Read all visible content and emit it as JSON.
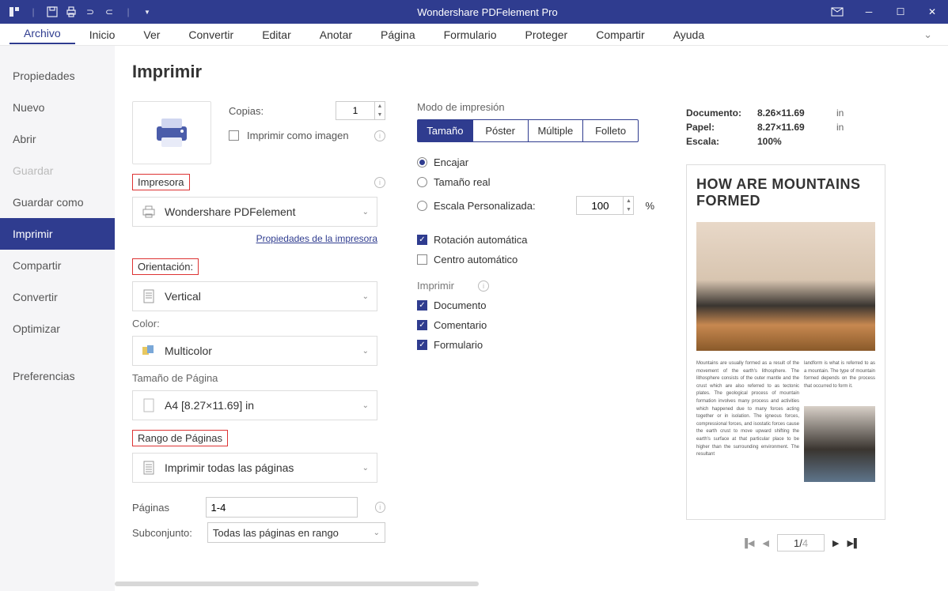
{
  "app_title": "Wondershare PDFelement Pro",
  "menu": {
    "items": [
      "Archivo",
      "Inicio",
      "Ver",
      "Convertir",
      "Editar",
      "Anotar",
      "Página",
      "Formulario",
      "Proteger",
      "Compartir",
      "Ayuda"
    ],
    "active": "Archivo"
  },
  "sidebar": {
    "items": [
      {
        "label": "Propiedades"
      },
      {
        "label": "Nuevo"
      },
      {
        "label": "Abrir"
      },
      {
        "label": "Guardar",
        "disabled": true
      },
      {
        "label": "Guardar como"
      },
      {
        "label": "Imprimir",
        "active": true
      },
      {
        "label": "Compartir"
      },
      {
        "label": "Convertir"
      },
      {
        "label": "Optimizar"
      }
    ],
    "prefs": "Preferencias"
  },
  "print": {
    "title": "Imprimir",
    "copies_label": "Copias:",
    "copies_value": "1",
    "print_as_image": "Imprimir como imagen",
    "printer_section": "Impresora",
    "printer_value": "Wondershare PDFelement",
    "printer_props_link": "Propiedades de la impresora",
    "orientation_section": "Orientación:",
    "orientation_value": "Vertical",
    "color_section": "Color:",
    "color_value": "Multicolor",
    "page_size_section": "Tamaño de Página",
    "page_size_value": "A4 [8.27×11.69] in",
    "page_range_section": "Rango de Páginas",
    "page_range_value": "Imprimir todas las páginas",
    "pages_label": "Páginas",
    "pages_value": "1-4",
    "subset_label": "Subconjunto:",
    "subset_value": "Todas las páginas en rango"
  },
  "mode": {
    "label": "Modo de impresión",
    "tabs": [
      "Tamaño",
      "Póster",
      "Múltiple",
      "Folleto"
    ],
    "fit": "Encajar",
    "actual": "Tamaño real",
    "custom": "Escala Personalizada:",
    "scale_value": "100",
    "percent": "%",
    "auto_rotate": "Rotación automática",
    "auto_center": "Centro automático",
    "print_label": "Imprimir",
    "print_doc": "Documento",
    "print_comment": "Comentario",
    "print_form": "Formulario"
  },
  "preview": {
    "doc_label": "Documento:",
    "doc_v": "8.26×11.69",
    "doc_u": "in",
    "paper_label": "Papel:",
    "paper_v": "8.27×11.69",
    "paper_u": "in",
    "scale_label": "Escala:",
    "scale_v": "100%",
    "page_title": "HOW ARE MOUNTAINS FORMED",
    "body1": "Mountains are usually formed as a result of the movement of the earth's lithosphere. The lithosphere consists of the outer mantle and the crust which are also referred to as tectonic plates. The geological process of mountain formation involves many process and activities which happened due to many forces acting together or in isolation. The igneous forces, compressional forces, and isostatic forces cause the earth crust to move upward shifting the earth's surface at that particular place to be higher than the surrounding environment. The resultant",
    "body2": "landform is what is referred to as a mountain. The type of mountain formed depends on the process that occurred to form it.",
    "pager_current": "1",
    "pager_total": "4"
  }
}
